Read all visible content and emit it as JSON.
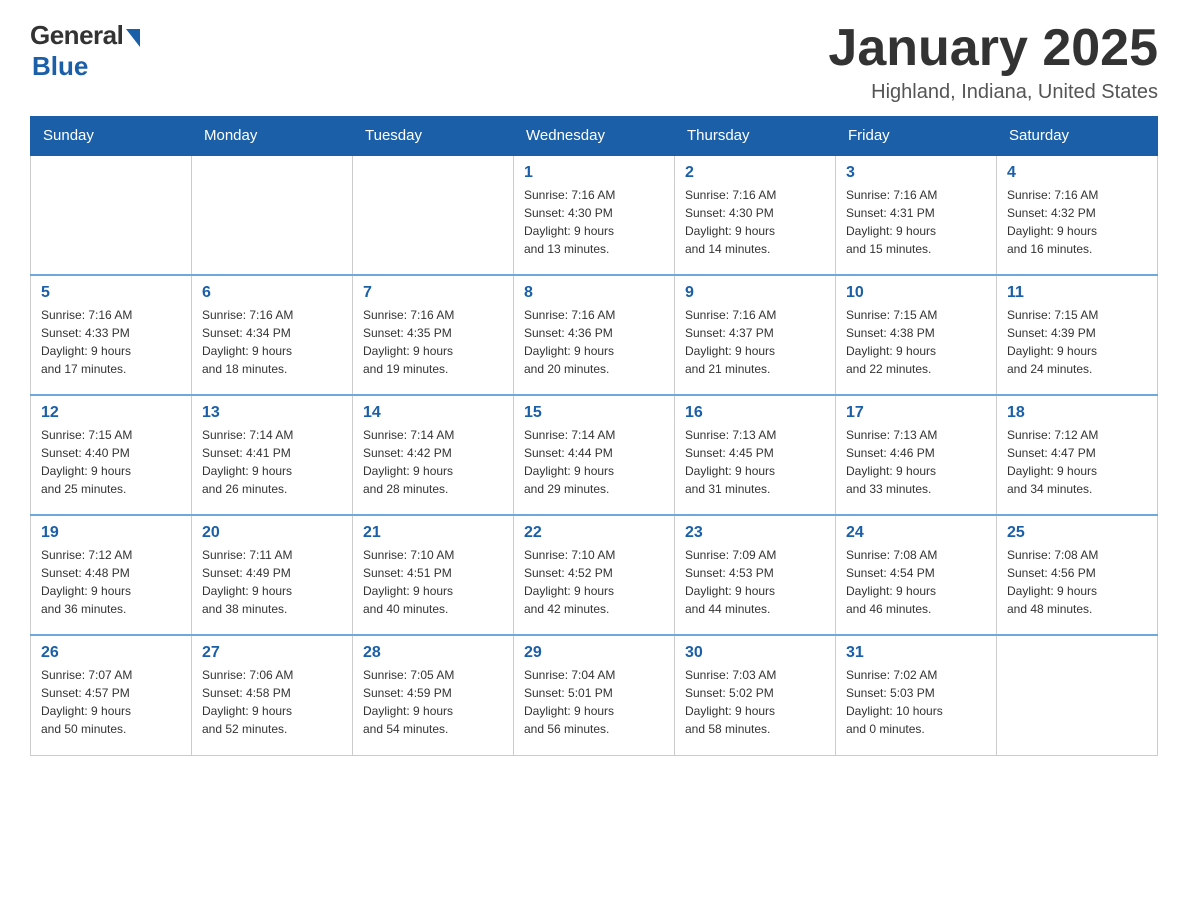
{
  "logo": {
    "general": "General",
    "blue": "Blue",
    "subtitle": "Blue"
  },
  "title": "January 2025",
  "location": "Highland, Indiana, United States",
  "days_of_week": [
    "Sunday",
    "Monday",
    "Tuesday",
    "Wednesday",
    "Thursday",
    "Friday",
    "Saturday"
  ],
  "weeks": [
    [
      {
        "day": "",
        "info": ""
      },
      {
        "day": "",
        "info": ""
      },
      {
        "day": "",
        "info": ""
      },
      {
        "day": "1",
        "info": "Sunrise: 7:16 AM\nSunset: 4:30 PM\nDaylight: 9 hours\nand 13 minutes."
      },
      {
        "day": "2",
        "info": "Sunrise: 7:16 AM\nSunset: 4:30 PM\nDaylight: 9 hours\nand 14 minutes."
      },
      {
        "day": "3",
        "info": "Sunrise: 7:16 AM\nSunset: 4:31 PM\nDaylight: 9 hours\nand 15 minutes."
      },
      {
        "day": "4",
        "info": "Sunrise: 7:16 AM\nSunset: 4:32 PM\nDaylight: 9 hours\nand 16 minutes."
      }
    ],
    [
      {
        "day": "5",
        "info": "Sunrise: 7:16 AM\nSunset: 4:33 PM\nDaylight: 9 hours\nand 17 minutes."
      },
      {
        "day": "6",
        "info": "Sunrise: 7:16 AM\nSunset: 4:34 PM\nDaylight: 9 hours\nand 18 minutes."
      },
      {
        "day": "7",
        "info": "Sunrise: 7:16 AM\nSunset: 4:35 PM\nDaylight: 9 hours\nand 19 minutes."
      },
      {
        "day": "8",
        "info": "Sunrise: 7:16 AM\nSunset: 4:36 PM\nDaylight: 9 hours\nand 20 minutes."
      },
      {
        "day": "9",
        "info": "Sunrise: 7:16 AM\nSunset: 4:37 PM\nDaylight: 9 hours\nand 21 minutes."
      },
      {
        "day": "10",
        "info": "Sunrise: 7:15 AM\nSunset: 4:38 PM\nDaylight: 9 hours\nand 22 minutes."
      },
      {
        "day": "11",
        "info": "Sunrise: 7:15 AM\nSunset: 4:39 PM\nDaylight: 9 hours\nand 24 minutes."
      }
    ],
    [
      {
        "day": "12",
        "info": "Sunrise: 7:15 AM\nSunset: 4:40 PM\nDaylight: 9 hours\nand 25 minutes."
      },
      {
        "day": "13",
        "info": "Sunrise: 7:14 AM\nSunset: 4:41 PM\nDaylight: 9 hours\nand 26 minutes."
      },
      {
        "day": "14",
        "info": "Sunrise: 7:14 AM\nSunset: 4:42 PM\nDaylight: 9 hours\nand 28 minutes."
      },
      {
        "day": "15",
        "info": "Sunrise: 7:14 AM\nSunset: 4:44 PM\nDaylight: 9 hours\nand 29 minutes."
      },
      {
        "day": "16",
        "info": "Sunrise: 7:13 AM\nSunset: 4:45 PM\nDaylight: 9 hours\nand 31 minutes."
      },
      {
        "day": "17",
        "info": "Sunrise: 7:13 AM\nSunset: 4:46 PM\nDaylight: 9 hours\nand 33 minutes."
      },
      {
        "day": "18",
        "info": "Sunrise: 7:12 AM\nSunset: 4:47 PM\nDaylight: 9 hours\nand 34 minutes."
      }
    ],
    [
      {
        "day": "19",
        "info": "Sunrise: 7:12 AM\nSunset: 4:48 PM\nDaylight: 9 hours\nand 36 minutes."
      },
      {
        "day": "20",
        "info": "Sunrise: 7:11 AM\nSunset: 4:49 PM\nDaylight: 9 hours\nand 38 minutes."
      },
      {
        "day": "21",
        "info": "Sunrise: 7:10 AM\nSunset: 4:51 PM\nDaylight: 9 hours\nand 40 minutes."
      },
      {
        "day": "22",
        "info": "Sunrise: 7:10 AM\nSunset: 4:52 PM\nDaylight: 9 hours\nand 42 minutes."
      },
      {
        "day": "23",
        "info": "Sunrise: 7:09 AM\nSunset: 4:53 PM\nDaylight: 9 hours\nand 44 minutes."
      },
      {
        "day": "24",
        "info": "Sunrise: 7:08 AM\nSunset: 4:54 PM\nDaylight: 9 hours\nand 46 minutes."
      },
      {
        "day": "25",
        "info": "Sunrise: 7:08 AM\nSunset: 4:56 PM\nDaylight: 9 hours\nand 48 minutes."
      }
    ],
    [
      {
        "day": "26",
        "info": "Sunrise: 7:07 AM\nSunset: 4:57 PM\nDaylight: 9 hours\nand 50 minutes."
      },
      {
        "day": "27",
        "info": "Sunrise: 7:06 AM\nSunset: 4:58 PM\nDaylight: 9 hours\nand 52 minutes."
      },
      {
        "day": "28",
        "info": "Sunrise: 7:05 AM\nSunset: 4:59 PM\nDaylight: 9 hours\nand 54 minutes."
      },
      {
        "day": "29",
        "info": "Sunrise: 7:04 AM\nSunset: 5:01 PM\nDaylight: 9 hours\nand 56 minutes."
      },
      {
        "day": "30",
        "info": "Sunrise: 7:03 AM\nSunset: 5:02 PM\nDaylight: 9 hours\nand 58 minutes."
      },
      {
        "day": "31",
        "info": "Sunrise: 7:02 AM\nSunset: 5:03 PM\nDaylight: 10 hours\nand 0 minutes."
      },
      {
        "day": "",
        "info": ""
      }
    ]
  ]
}
